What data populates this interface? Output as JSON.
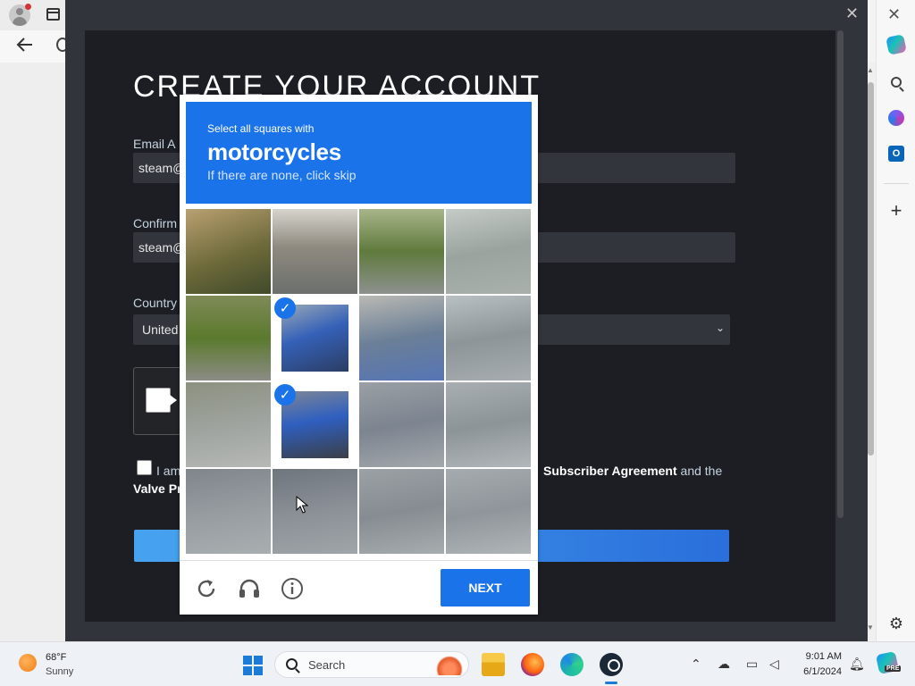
{
  "steam": {
    "title": "CREATE YOUR ACCOUNT",
    "email_label": "Email A",
    "email_value": "steam@",
    "confirm_label": "Confirm",
    "confirm_value": "steam@",
    "country_label": "Country",
    "country_value": "United",
    "agree_prefix": "I am",
    "agree_link_ssa": "Subscriber Agreement",
    "agree_and_the": " and the",
    "agree_link_valve": "Valve Pr",
    "close_glyph": "✕"
  },
  "recaptcha": {
    "prompt": "Select all squares with",
    "target": "motorcycles",
    "hint": "If there are none, click skip",
    "next_label": "NEXT",
    "tiles_selected": [
      5,
      9
    ],
    "tools": [
      "reload-icon",
      "audio-icon",
      "info-icon"
    ]
  },
  "edge": {
    "close_glyph": "✕",
    "sidebar_icons": [
      "copilot-icon",
      "search-icon",
      "microsoft365-icon",
      "outlook-icon",
      "add-icon",
      "settings-icon"
    ]
  },
  "taskbar": {
    "weather_temp": "68°F",
    "weather_cond": "Sunny",
    "search_placeholder": "Search",
    "clock_time": "9:01 AM",
    "clock_date": "6/1/2024",
    "copilot_badge": "PRE"
  },
  "colors": {
    "recaptcha_blue": "#1a73e8",
    "steam_bg": "#1c1e24",
    "steam_input": "#32353c",
    "steam_button": "#47a3f0"
  }
}
